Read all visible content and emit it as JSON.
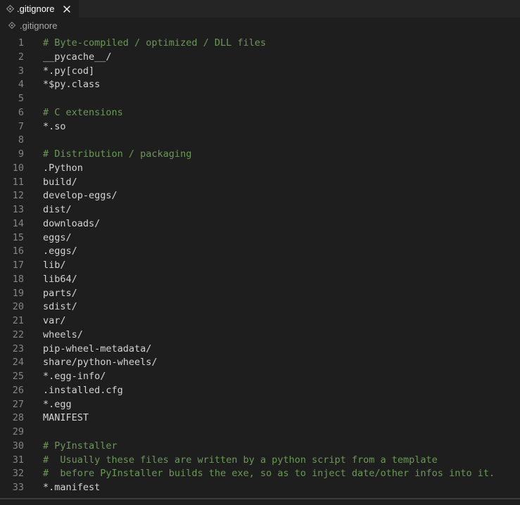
{
  "tab": {
    "label": ".gitignore",
    "icon": "gitignore-file-icon",
    "close_icon": "close-icon"
  },
  "breadcrumb": {
    "label": ".gitignore"
  },
  "colors": {
    "background": "#1e1e1e",
    "tabbar": "#252526",
    "line_number": "#858585",
    "text": "#d4d4d4",
    "comment": "#6a9955"
  },
  "lines": [
    {
      "n": "1",
      "text": "# Byte-compiled / optimized / DLL files",
      "kind": "comment"
    },
    {
      "n": "2",
      "text": "__pycache__/",
      "kind": "text"
    },
    {
      "n": "3",
      "text": "*.py[cod]",
      "kind": "text"
    },
    {
      "n": "4",
      "text": "*$py.class",
      "kind": "text"
    },
    {
      "n": "5",
      "text": "",
      "kind": "text"
    },
    {
      "n": "6",
      "text": "# C extensions",
      "kind": "comment"
    },
    {
      "n": "7",
      "text": "*.so",
      "kind": "text"
    },
    {
      "n": "8",
      "text": "",
      "kind": "text"
    },
    {
      "n": "9",
      "text": "# Distribution / packaging",
      "kind": "comment"
    },
    {
      "n": "10",
      "text": ".Python",
      "kind": "text"
    },
    {
      "n": "11",
      "text": "build/",
      "kind": "text"
    },
    {
      "n": "12",
      "text": "develop-eggs/",
      "kind": "text"
    },
    {
      "n": "13",
      "text": "dist/",
      "kind": "text"
    },
    {
      "n": "14",
      "text": "downloads/",
      "kind": "text"
    },
    {
      "n": "15",
      "text": "eggs/",
      "kind": "text"
    },
    {
      "n": "16",
      "text": ".eggs/",
      "kind": "text"
    },
    {
      "n": "17",
      "text": "lib/",
      "kind": "text"
    },
    {
      "n": "18",
      "text": "lib64/",
      "kind": "text"
    },
    {
      "n": "19",
      "text": "parts/",
      "kind": "text"
    },
    {
      "n": "20",
      "text": "sdist/",
      "kind": "text"
    },
    {
      "n": "21",
      "text": "var/",
      "kind": "text"
    },
    {
      "n": "22",
      "text": "wheels/",
      "kind": "text"
    },
    {
      "n": "23",
      "text": "pip-wheel-metadata/",
      "kind": "text"
    },
    {
      "n": "24",
      "text": "share/python-wheels/",
      "kind": "text"
    },
    {
      "n": "25",
      "text": "*.egg-info/",
      "kind": "text"
    },
    {
      "n": "26",
      "text": ".installed.cfg",
      "kind": "text"
    },
    {
      "n": "27",
      "text": "*.egg",
      "kind": "text"
    },
    {
      "n": "28",
      "text": "MANIFEST",
      "kind": "text"
    },
    {
      "n": "29",
      "text": "",
      "kind": "text"
    },
    {
      "n": "30",
      "text": "# PyInstaller",
      "kind": "comment"
    },
    {
      "n": "31",
      "text": "#  Usually these files are written by a python script from a template",
      "kind": "comment"
    },
    {
      "n": "32",
      "text": "#  before PyInstaller builds the exe, so as to inject date/other infos into it.",
      "kind": "comment"
    },
    {
      "n": "33",
      "text": "*.manifest",
      "kind": "text"
    }
  ]
}
